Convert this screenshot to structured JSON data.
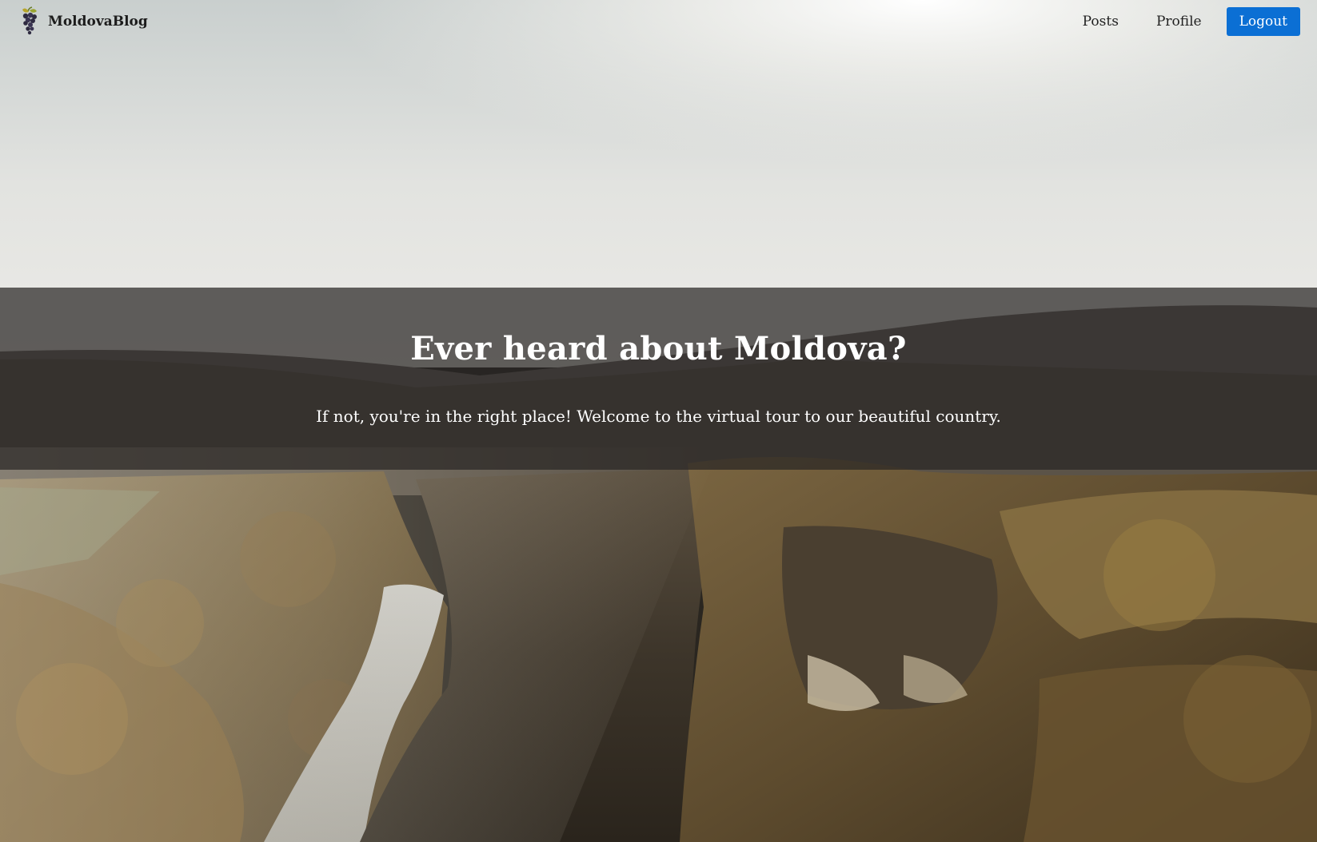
{
  "navbar": {
    "brand_name": "MoldovaBlog",
    "brand_icon": "grapes-icon",
    "links": [
      {
        "label": "Posts"
      },
      {
        "label": "Profile"
      }
    ],
    "logout_label": "Logout",
    "logout_color": "#0b6fd4"
  },
  "hero": {
    "title": "Ever heard about Moldova?",
    "subtitle": "If not, you're in the right place! Welcome to the virtual tour to our beautiful country.",
    "background": "landscape-photo-river-canyon-monastery"
  }
}
